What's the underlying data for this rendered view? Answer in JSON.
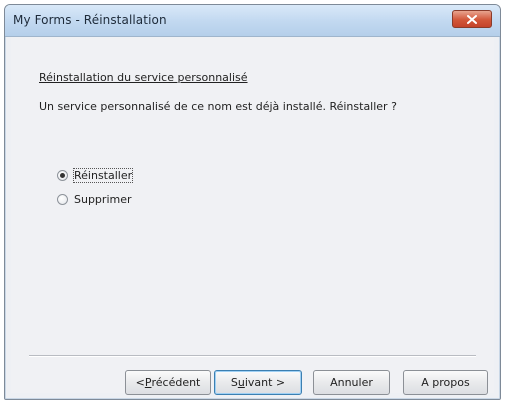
{
  "window": {
    "title": "My Forms - Réinstallation",
    "close_icon": "close-icon"
  },
  "content": {
    "heading": "Réinstallation du service personnalisé",
    "question": "Un service personnalisé de ce nom est déjà installé. Réinstaller ?"
  },
  "options": [
    {
      "label": "Réinstaller",
      "selected": true
    },
    {
      "label": "Supprimer",
      "selected": false
    }
  ],
  "buttons": {
    "previous": {
      "prefix": "< ",
      "access": "P",
      "rest": "récédent"
    },
    "next": {
      "pre": "S",
      "access": "u",
      "rest": "ivant >"
    },
    "cancel": "Annuler",
    "about": "A propos"
  },
  "colors": {
    "titlebar": "#c1d8f0",
    "close_button": "#d2573a",
    "dialog_background": "#f0f1f4"
  }
}
